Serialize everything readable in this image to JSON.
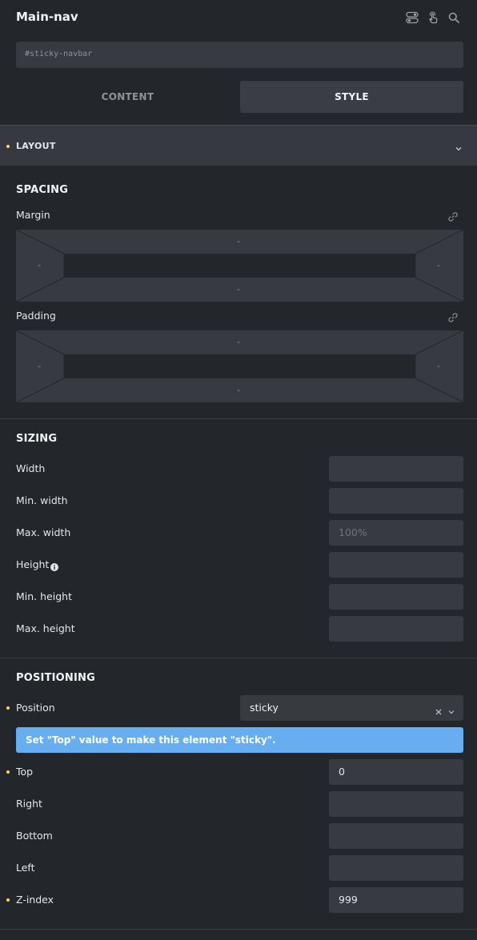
{
  "header": {
    "title": "Main-nav",
    "icons": [
      "toggle-icon",
      "touch-icon",
      "search-icon"
    ]
  },
  "css_id": {
    "value": "#sticky-navbar"
  },
  "tabs": [
    {
      "label": "CONTENT",
      "active": false
    },
    {
      "label": "STYLE",
      "active": true
    }
  ],
  "layout": {
    "label": "LAYOUT",
    "expanded": false
  },
  "spacing": {
    "title": "SPACING",
    "margin": {
      "label": "Margin",
      "top": "-",
      "right": "-",
      "bottom": "-",
      "left": "-"
    },
    "padding": {
      "label": "Padding",
      "top": "-",
      "right": "-",
      "bottom": "-",
      "left": "-"
    }
  },
  "sizing": {
    "title": "SIZING",
    "rows": [
      {
        "label": "Width",
        "value": "",
        "placeholder": ""
      },
      {
        "label": "Min. width",
        "value": "",
        "placeholder": ""
      },
      {
        "label": "Max. width",
        "value": "",
        "placeholder": "100%"
      },
      {
        "label": "Height",
        "value": "",
        "placeholder": ""
      },
      {
        "label": "Min. height",
        "value": "",
        "placeholder": ""
      },
      {
        "label": "Max. height",
        "value": "",
        "placeholder": ""
      }
    ]
  },
  "positioning": {
    "title": "POSITIONING",
    "position_label": "Position",
    "position_value": "sticky",
    "alert": "Set \"Top\" value to make this element \"sticky\".",
    "rows": [
      {
        "label": "Top",
        "value": "0"
      },
      {
        "label": "Right",
        "value": ""
      },
      {
        "label": "Bottom",
        "value": ""
      },
      {
        "label": "Left",
        "value": ""
      },
      {
        "label": "Z-index",
        "value": "999"
      }
    ]
  },
  "colors": {
    "background": "#23262b",
    "panel": "#373a41",
    "accent_dot": "#ffd64f",
    "alert": "#66aef0"
  }
}
